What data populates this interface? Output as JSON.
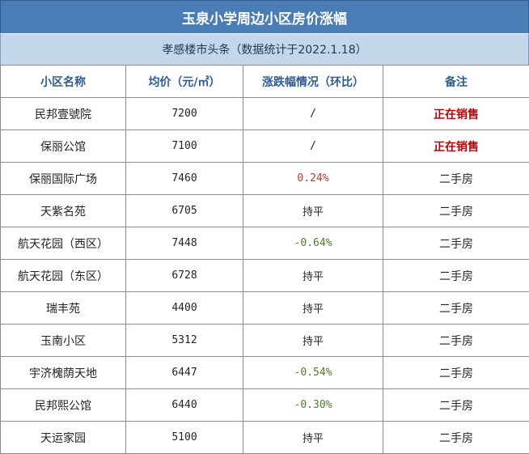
{
  "title": "玉泉小学周边小区房价涨幅",
  "subtitle": "孝感楼市头条（数据统计于2022.1.18）",
  "colors": {
    "title_bg": "#4a7cb5",
    "subtitle_bg": "#c4d6ea",
    "header_text": "#2d5c95",
    "up": "#c0392b",
    "down": "#4e7a2a",
    "sale": "#c00000"
  },
  "headers": [
    "小区名称",
    "均价（元/㎡）",
    "涨跌幅情况（环比）",
    "备注"
  ],
  "rows": [
    {
      "name": "民邦壹號院",
      "price": "7200",
      "change": "/",
      "change_type": "flat",
      "note": "正在销售",
      "note_type": "sale"
    },
    {
      "name": "保丽公馆",
      "price": "7100",
      "change": "/",
      "change_type": "flat",
      "note": "正在销售",
      "note_type": "sale"
    },
    {
      "name": "保丽国际广场",
      "price": "7460",
      "change": "0.24%",
      "change_type": "up",
      "note": "二手房",
      "note_type": "normal"
    },
    {
      "name": "天紫名苑",
      "price": "6705",
      "change": "持平",
      "change_type": "flat",
      "note": "二手房",
      "note_type": "normal"
    },
    {
      "name": "航天花园（西区）",
      "price": "7448",
      "change": "-0.64%",
      "change_type": "down",
      "note": "二手房",
      "note_type": "normal"
    },
    {
      "name": "航天花园（东区）",
      "price": "6728",
      "change": "持平",
      "change_type": "flat",
      "note": "二手房",
      "note_type": "normal"
    },
    {
      "name": "瑞丰苑",
      "price": "4400",
      "change": "持平",
      "change_type": "flat",
      "note": "二手房",
      "note_type": "normal"
    },
    {
      "name": "玉南小区",
      "price": "5312",
      "change": "持平",
      "change_type": "flat",
      "note": "二手房",
      "note_type": "normal"
    },
    {
      "name": "宇济槐荫天地",
      "price": "6447",
      "change": "-0.54%",
      "change_type": "down",
      "note": "二手房",
      "note_type": "normal"
    },
    {
      "name": "民邦熙公馆",
      "price": "6440",
      "change": "-0.30%",
      "change_type": "down",
      "note": "二手房",
      "note_type": "normal"
    },
    {
      "name": "天运家园",
      "price": "5100",
      "change": "持平",
      "change_type": "flat",
      "note": "二手房",
      "note_type": "normal"
    }
  ]
}
